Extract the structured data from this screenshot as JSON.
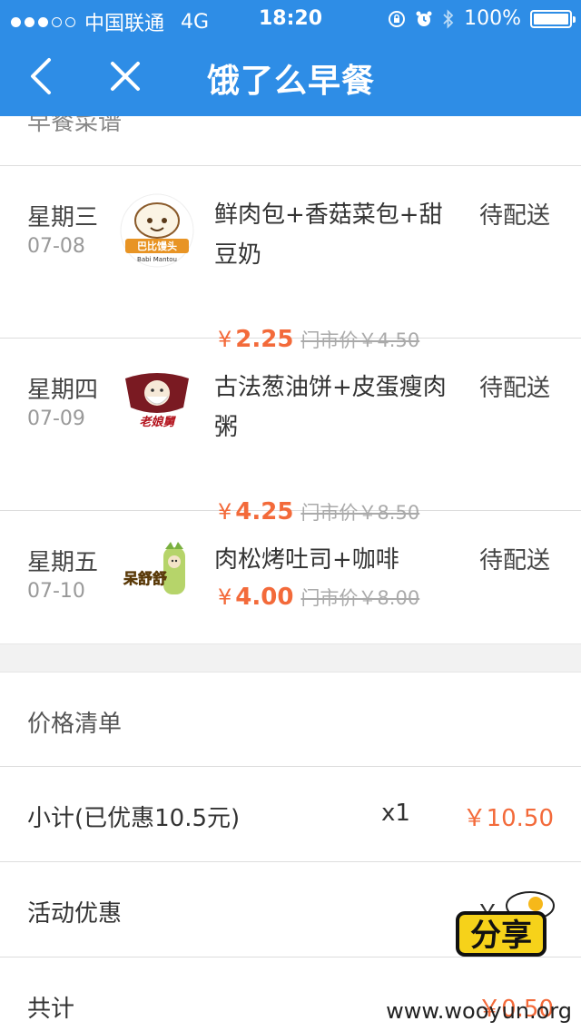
{
  "status_bar": {
    "carrier": "中国联通",
    "network": "4G",
    "time": "18:20",
    "battery": "100%"
  },
  "navbar": {
    "title": "饿了么早餐"
  },
  "menu_section": {
    "title": "早餐菜谱",
    "items": [
      {
        "day": "星期三",
        "date": "07-08",
        "name": "鲜肉包+香菇菜包+甜豆奶",
        "status": "待配送",
        "currency": "¥",
        "price": "2.25",
        "market_price": "门市价￥4.50",
        "logo_text": "巴比馒头",
        "logo_subtext": "Babi Mantou"
      },
      {
        "day": "星期四",
        "date": "07-09",
        "name": "古法葱油饼+皮蛋瘦肉粥",
        "status": "待配送",
        "currency": "¥",
        "price": "4.25",
        "market_price": "门市价￥8.50",
        "logo_text": "老娘舅"
      },
      {
        "day": "星期五",
        "date": "07-10",
        "name": "肉松烤吐司+咖啡",
        "status": "待配送",
        "currency": "¥",
        "price": "4.00",
        "market_price": "门市价￥8.00",
        "logo_text": "呆舒舒"
      }
    ]
  },
  "price_list": {
    "title": "价格清单",
    "rows": [
      {
        "label": "小计(已优惠10.5元)",
        "qty": "x1",
        "amount": "￥10.50"
      },
      {
        "label": "活动优惠",
        "qty": "",
        "amount": "-￥"
      },
      {
        "label": "共计",
        "qty": "",
        "amount": "￥0.50"
      }
    ]
  },
  "watermark": {
    "logo_text": "分享",
    "site": "www.wooyun.org"
  },
  "colors": {
    "brand_blue": "#2e8de6",
    "price_orange": "#f36a3a"
  }
}
